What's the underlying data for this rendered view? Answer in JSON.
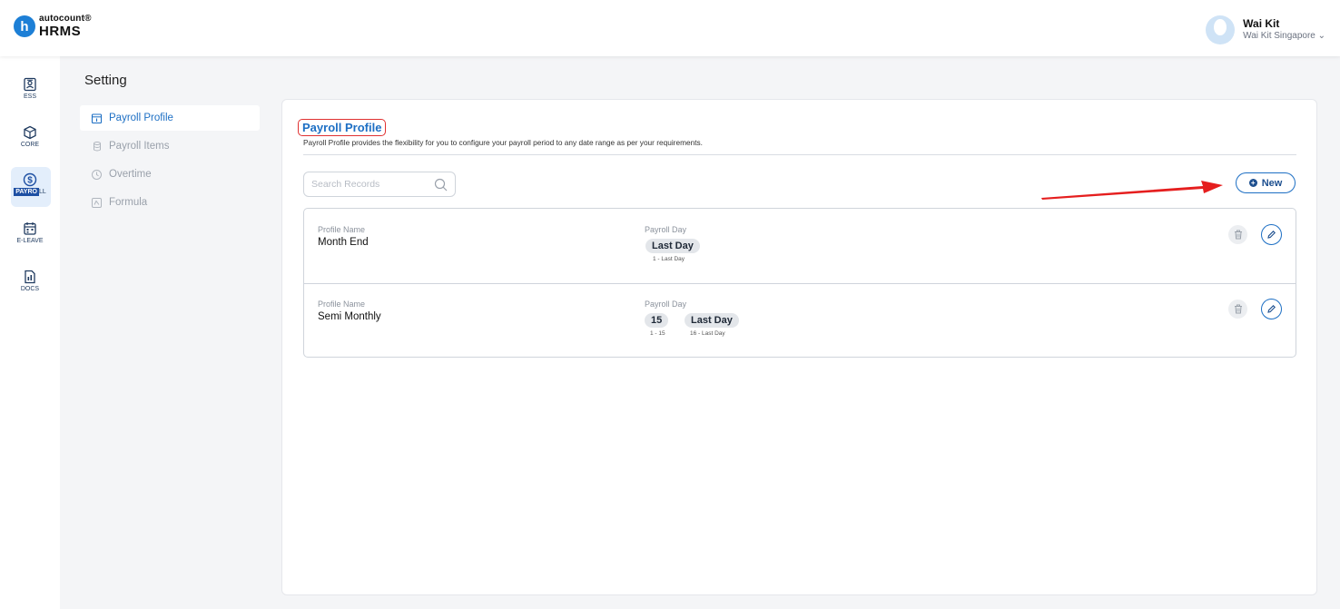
{
  "brand": {
    "logo_letter": "h",
    "logo_top": "autocount®",
    "logo_bottom": "HRMS"
  },
  "user": {
    "name": "Wai Kit",
    "company": "Wai Kit Singapore ⌄"
  },
  "rail": {
    "items": [
      {
        "label": "ESS",
        "icon": "id-card-icon"
      },
      {
        "label": "CORE",
        "icon": "cube-icon"
      },
      {
        "label": "PAYROLL",
        "label_highlight": "PAYRO",
        "label_rest": "LL",
        "icon": "dollar-icon",
        "active": true
      },
      {
        "label": "E-LEAVE",
        "icon": "calendar-icon"
      },
      {
        "label": "DOCS",
        "icon": "document-icon"
      }
    ]
  },
  "page": {
    "title": "Setting"
  },
  "submenu": {
    "items": [
      {
        "label": "Payroll Profile",
        "icon": "calendar-icon",
        "active": true
      },
      {
        "label": "Payroll Items",
        "icon": "coins-icon"
      },
      {
        "label": "Overtime",
        "icon": "clock-icon"
      },
      {
        "label": "Formula",
        "icon": "formula-icon"
      }
    ]
  },
  "panel": {
    "title": "Payroll Profile",
    "description": "Payroll Profile provides the flexibility for you to configure your payroll period to any date range as per your requirements.",
    "search_placeholder": "Search Records",
    "new_label": "New",
    "records": [
      {
        "profile_label": "Profile Name",
        "profile_name": "Month End",
        "day_label": "Payroll Day",
        "days": [
          {
            "chip": "Last Day",
            "sub": "1 - Last Day"
          }
        ]
      },
      {
        "profile_label": "Profile Name",
        "profile_name": "Semi Monthly",
        "day_label": "Payroll Day",
        "days": [
          {
            "chip": "15",
            "sub": "1 - 15"
          },
          {
            "chip": "Last Day",
            "sub": "16 - Last Day"
          }
        ]
      }
    ]
  },
  "colors": {
    "accent": "#1d6fc4",
    "annotation": "#e03131",
    "rail_active_bg": "#e3eefb"
  }
}
